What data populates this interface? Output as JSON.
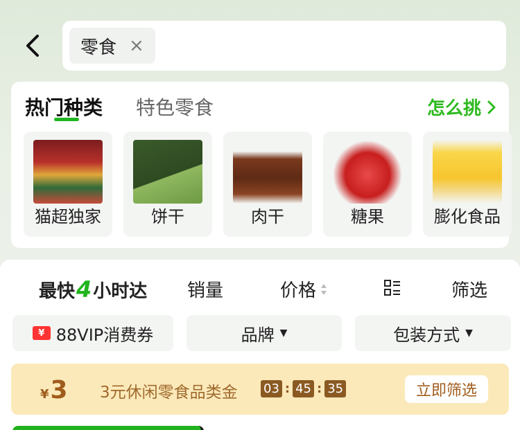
{
  "header": {
    "search_tag": "零食",
    "clear_symbol": "×"
  },
  "categories": {
    "tabs": [
      {
        "label": "热门种类",
        "active": true
      },
      {
        "label": "特色零食",
        "active": false
      }
    ],
    "how_to_pick": "怎么挑",
    "items": [
      {
        "label": "猫超独家",
        "icon": "gift-box-image"
      },
      {
        "label": "饼干",
        "icon": "biscuit-image"
      },
      {
        "label": "肉干",
        "icon": "jerky-image"
      },
      {
        "label": "糖果",
        "icon": "candy-image"
      },
      {
        "label": "膨化食品",
        "icon": "chips-image"
      }
    ]
  },
  "sort": {
    "fast_prefix": "最快",
    "fast_num": "4",
    "fast_suffix": "小时达",
    "sales": "销量",
    "price": "价格",
    "filter": "筛选"
  },
  "chips": {
    "vip_badge": "¥",
    "vip": "88VIP消费券",
    "brand": "品牌",
    "packaging": "包装方式"
  },
  "coupon": {
    "currency": "¥",
    "amount": "3",
    "description": "3元休闲零食品类金",
    "timer": [
      "03",
      "45",
      "35"
    ],
    "button": "立即筛选"
  },
  "colors": {
    "accent_green": "#22b41e",
    "coupon_bg": "#fbe9ba",
    "coupon_text": "#a05c1c"
  }
}
